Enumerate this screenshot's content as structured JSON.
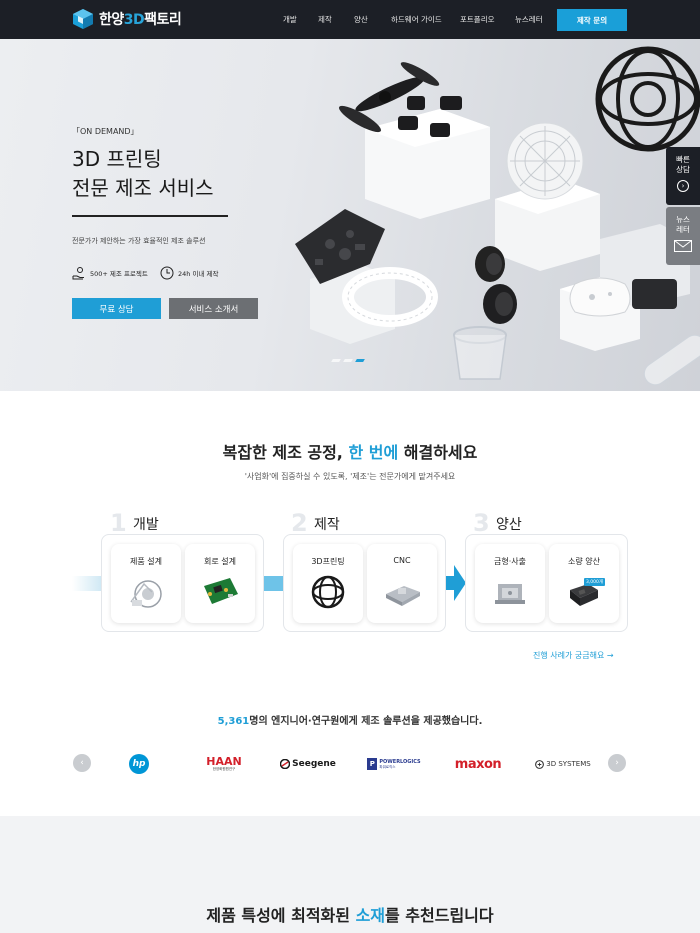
{
  "header": {
    "logo_prefix": "한양",
    "logo_accent": "3D",
    "logo_suffix": "팩토리",
    "menu": [
      "개발",
      "제작",
      "양산",
      "하드웨어 가이드",
      "포트폴리오",
      "뉴스레터"
    ],
    "cta": "제작 문의"
  },
  "hero": {
    "eyebrow": "「ON DEMAND」",
    "title_line1": "3D 프린팅",
    "title_line2": "전문 제조 서비스",
    "subtitle": "전문가가 제안하는 가장 효율적인 제조 솔루션",
    "feature1": "500+ 제조 프로젝트",
    "feature2": "24h 이내 제작",
    "btn_primary": "무료 상담",
    "btn_secondary": "서비스 소개서",
    "slides_active": 3,
    "slides_total": 3
  },
  "side": {
    "quick_line1": "빠른",
    "quick_line2": "상담",
    "news_line1": "뉴스",
    "news_line2": "레터"
  },
  "process": {
    "title_pre": "복잡한 제조 공정, ",
    "title_accent": "한 번에",
    "title_post": " 해결하세요",
    "subtitle": "'사업화'에 집중하실 수 있도록, '제조'는 전문가에게 맡겨주세요",
    "stages": [
      {
        "num": "1",
        "label": "개발",
        "items": [
          "제품 설계",
          "회로 설계"
        ]
      },
      {
        "num": "2",
        "label": "제작",
        "items": [
          "3D프린팅",
          "CNC"
        ]
      },
      {
        "num": "3",
        "label": "양산",
        "items": [
          "금형·사출",
          "소량 양산"
        ]
      }
    ],
    "small_badge": "3,000개",
    "more_link": "진행 사례가 궁금해요 →"
  },
  "clients": {
    "count": "5,361",
    "text": "명의 엔지니어·연구원에게 제조 솔루션을 제공했습니다.",
    "brands": [
      "hp",
      "HAAN",
      "한양화원원연구",
      "Seegene",
      "POWERLOGICS",
      "파워로직스",
      "maxon",
      "3D SYSTEMS"
    ],
    "prev": "‹",
    "next": "›"
  },
  "materials": {
    "title_pre": "제품 특성에 최적화된 ",
    "title_accent": "소재",
    "title_post": "를 추천드립니다"
  },
  "colors": {
    "accent": "#1f9ed6",
    "nav_bg": "#1c1f26"
  }
}
